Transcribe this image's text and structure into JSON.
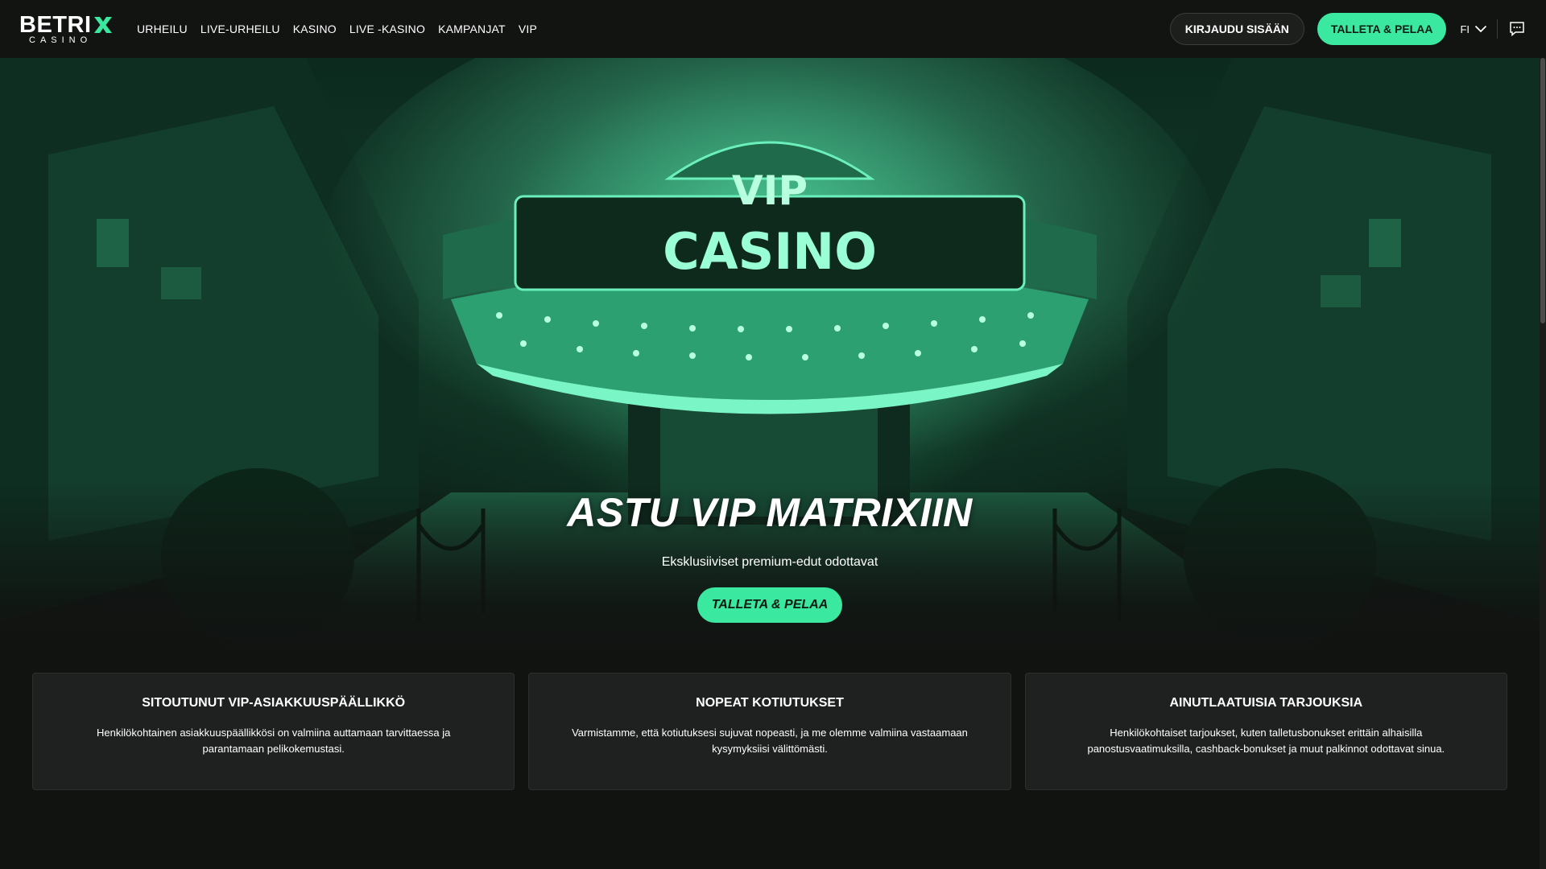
{
  "header": {
    "logo": {
      "name": "BETRIX",
      "name_main": "BETRI",
      "sub": "CASINO"
    },
    "nav": [
      "URHEILU",
      "LIVE-URHEILU",
      "KASINO",
      "LIVE -KASINO",
      "KAMPANJAT",
      "VIP"
    ],
    "login_label": "KIRJAUDU SISÄÄN",
    "deposit_label": "TALLETA & PELAA",
    "language": "FI",
    "icons": {
      "language_dropdown": "chevron-down-icon",
      "chat": "chat-icon"
    }
  },
  "hero": {
    "sign_top": "VIP",
    "sign_main": "CASINO",
    "title": "ASTU VIP MATRIXIIN",
    "subtitle": "Eksklusiiviset premium-edut odottavat",
    "cta_label": "TALLETA & PELAA"
  },
  "features": [
    {
      "title": "SITOUTUNUT VIP-ASIAKKUUSPÄÄLLIKKÖ",
      "text": "Henkilökohtainen asiakkuuspäällikkösi on valmiina auttamaan tarvittaessa ja parantamaan pelikokemustasi."
    },
    {
      "title": "NOPEAT KOTIUTUKSET",
      "text": "Varmistamme, että kotiutuksesi sujuvat nopeasti, ja me olemme valmiina vastaamaan kysymyksiisi välittömästi."
    },
    {
      "title": "AINUTLAATUISIA TARJOUKSIA",
      "text": "Henkilökohtaiset tarjoukset, kuten talletusbonukset erittäin alhaisilla panostusvaatimuksilla, cashback-bonukset ja muut palkinnot odottavat sinua."
    }
  ],
  "colors": {
    "accent": "#3be8a0",
    "background": "#111311",
    "card": "#1f2120",
    "hero_tint": "#1f8a5e"
  }
}
